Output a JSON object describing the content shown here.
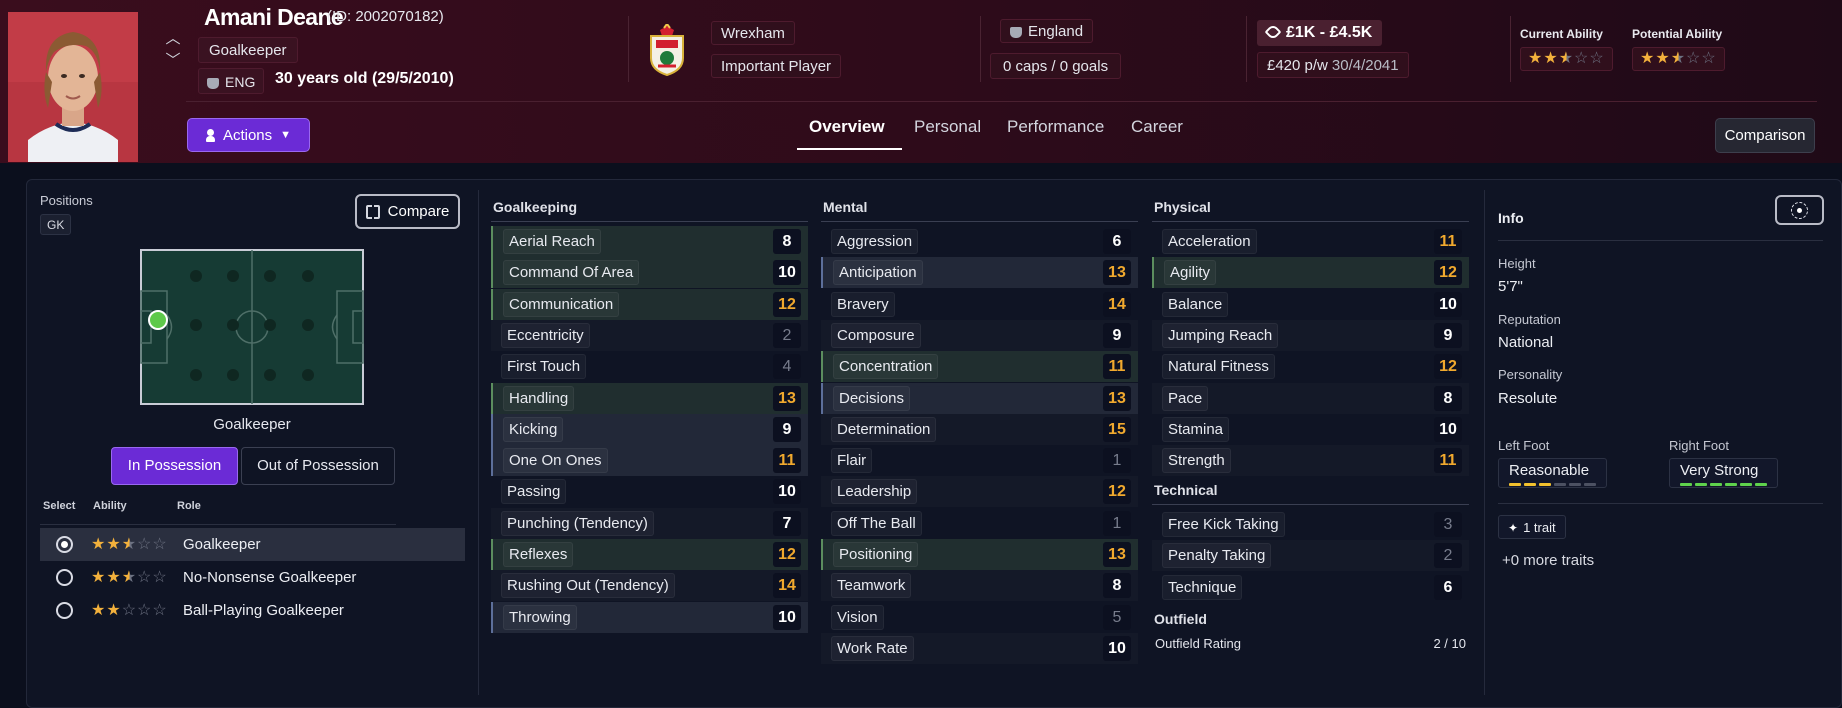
{
  "player": {
    "name": "Amani Deane",
    "id_text": "(ID: 2002070182)",
    "position": "Goalkeeper",
    "nationality_code": "ENG",
    "age_text": "30 years old (29/5/2010)"
  },
  "header": {
    "club": "Wrexham",
    "squad_status": "Important Player",
    "nation": "England",
    "caps_goals": "0 caps / 0 goals",
    "value": "£1K - £4.5K",
    "wage": "£420 p/w",
    "contract_expiry": "30/4/2041",
    "current_ability_label": "Current Ability",
    "potential_ability_label": "Potential Ability",
    "current_ability_stars": 2.5,
    "potential_ability_stars": 2.5,
    "actions_label": "Actions",
    "comparison_label": "Comparison"
  },
  "tabs": [
    "Overview",
    "Personal",
    "Performance",
    "Career"
  ],
  "active_tab": "Overview",
  "positions": {
    "label": "Positions",
    "chip": "GK",
    "compare_label": "Compare",
    "pitch_label": "Goalkeeper",
    "in_possession": "In Possession",
    "out_of_possession": "Out of Possession",
    "headers": {
      "select": "Select",
      "ability": "Ability",
      "role": "Role"
    },
    "roles": [
      {
        "name": "Goalkeeper",
        "stars": 2.5,
        "selected": true
      },
      {
        "name": "No-Nonsense Goalkeeper",
        "stars": 2.5,
        "selected": false
      },
      {
        "name": "Ball-Playing Goalkeeper",
        "stars": 2,
        "selected": false
      }
    ]
  },
  "goalkeeping": {
    "title": "Goalkeeping",
    "attributes": [
      {
        "name": "Aerial Reach",
        "value": "8"
      },
      {
        "name": "Command Of Area",
        "value": "10"
      },
      {
        "name": "Communication",
        "value": "12"
      },
      {
        "name": "Eccentricity",
        "value": "2"
      },
      {
        "name": "First Touch",
        "value": "4"
      },
      {
        "name": "Handling",
        "value": "13"
      },
      {
        "name": "Kicking",
        "value": "9"
      },
      {
        "name": "One On Ones",
        "value": "11"
      },
      {
        "name": "Passing",
        "value": "10"
      },
      {
        "name": "Punching (Tendency)",
        "value": "7"
      },
      {
        "name": "Reflexes",
        "value": "12"
      },
      {
        "name": "Rushing Out (Tendency)",
        "value": "14"
      },
      {
        "name": "Throwing",
        "value": "10"
      }
    ]
  },
  "mental": {
    "title": "Mental",
    "attributes": [
      {
        "name": "Aggression",
        "value": "6"
      },
      {
        "name": "Anticipation",
        "value": "13"
      },
      {
        "name": "Bravery",
        "value": "14"
      },
      {
        "name": "Composure",
        "value": "9"
      },
      {
        "name": "Concentration",
        "value": "11"
      },
      {
        "name": "Decisions",
        "value": "13"
      },
      {
        "name": "Determination",
        "value": "15"
      },
      {
        "name": "Flair",
        "value": "1"
      },
      {
        "name": "Leadership",
        "value": "12"
      },
      {
        "name": "Off The Ball",
        "value": "1"
      },
      {
        "name": "Positioning",
        "value": "13"
      },
      {
        "name": "Teamwork",
        "value": "8"
      },
      {
        "name": "Vision",
        "value": "5"
      },
      {
        "name": "Work Rate",
        "value": "10"
      }
    ]
  },
  "physical": {
    "title": "Physical",
    "attributes": [
      {
        "name": "Acceleration",
        "value": "11"
      },
      {
        "name": "Agility",
        "value": "12"
      },
      {
        "name": "Balance",
        "value": "10"
      },
      {
        "name": "Jumping Reach",
        "value": "9"
      },
      {
        "name": "Natural Fitness",
        "value": "12"
      },
      {
        "name": "Pace",
        "value": "8"
      },
      {
        "name": "Stamina",
        "value": "10"
      },
      {
        "name": "Strength",
        "value": "11"
      }
    ]
  },
  "technical": {
    "title": "Technical",
    "attributes": [
      {
        "name": "Free Kick Taking",
        "value": "3"
      },
      {
        "name": "Penalty Taking",
        "value": "2"
      },
      {
        "name": "Technique",
        "value": "6"
      }
    ]
  },
  "outfield": {
    "title": "Outfield",
    "rating_label": "Outfield Rating",
    "rating_value": "2 / 10"
  },
  "info": {
    "title": "Info",
    "height_label": "Height",
    "height": "5'7\"",
    "reputation_label": "Reputation",
    "reputation": "National",
    "personality_label": "Personality",
    "personality": "Resolute",
    "left_foot_label": "Left Foot",
    "left_foot": "Reasonable",
    "left_foot_level": 0.5,
    "right_foot_label": "Right Foot",
    "right_foot": "Very Strong",
    "right_foot_level": 1.0,
    "trait_count": "1 trait",
    "more_traits": "+0 more traits"
  },
  "colors": {
    "accent": "#6b2bd6",
    "star": "#f3b13c",
    "value_orange": "#f1a92e",
    "value_grey": "#777c8c",
    "foot_yellow": "#f2c12e",
    "foot_green": "#5fd34c"
  }
}
